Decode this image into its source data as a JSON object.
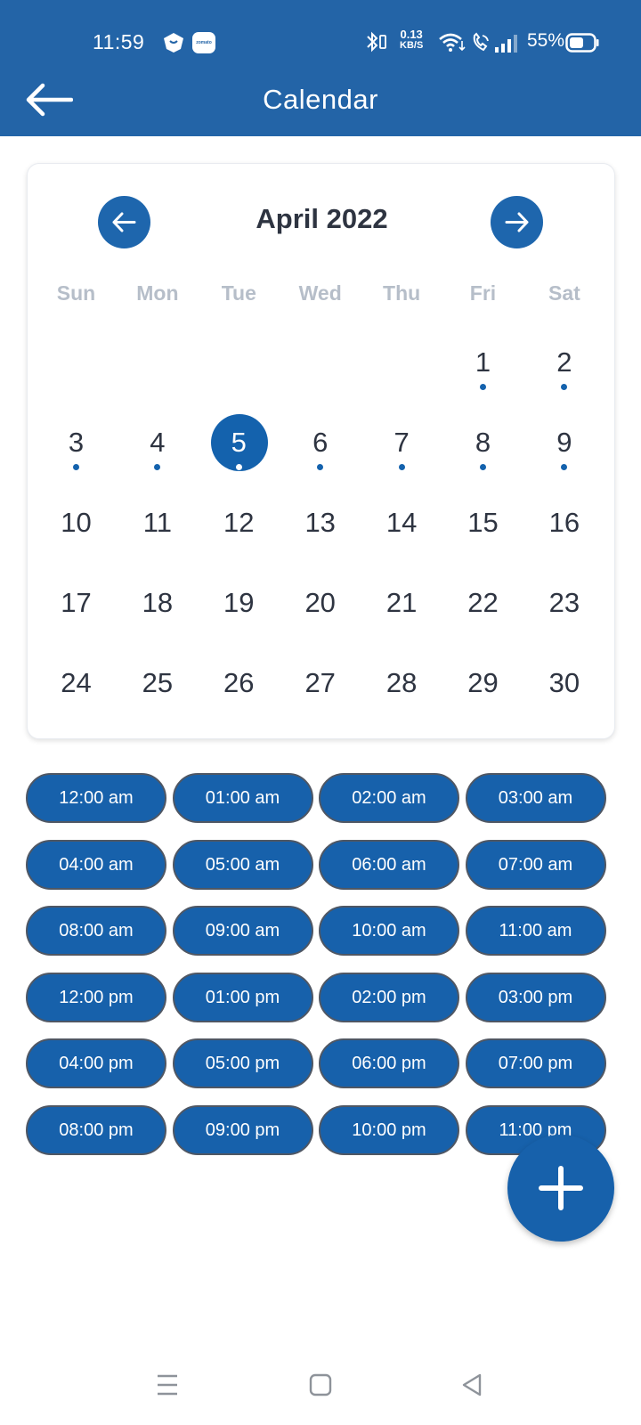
{
  "status_bar": {
    "time": "11:59",
    "speed_value": "0.13",
    "speed_unit": "KB/S",
    "battery": "55%",
    "app_badge": "zomato",
    "icons": [
      "app-notification-icon",
      "zomato-icon",
      "bluetooth-icon",
      "wifi-icon",
      "volte-call-icon",
      "signal-icon",
      "battery-icon"
    ]
  },
  "app_bar": {
    "title": "Calendar",
    "back_icon": "arrow-left-icon"
  },
  "calendar": {
    "month_title": "April 2022",
    "prev_icon": "arrow-left-icon",
    "next_icon": "arrow-right-icon",
    "weekdays": [
      "Sun",
      "Mon",
      "Tue",
      "Wed",
      "Thu",
      "Fri",
      "Sat"
    ],
    "first_weekday_index": 5,
    "days": [
      "1",
      "2",
      "3",
      "4",
      "5",
      "6",
      "7",
      "8",
      "9",
      "10",
      "11",
      "12",
      "13",
      "14",
      "15",
      "16",
      "17",
      "18",
      "19",
      "20",
      "21",
      "22",
      "23",
      "24",
      "25",
      "26",
      "27",
      "28",
      "29",
      "30"
    ],
    "selected_day": "5",
    "days_with_events": [
      "1",
      "2",
      "3",
      "4",
      "5",
      "6",
      "7",
      "8",
      "9"
    ]
  },
  "time_slots": [
    "12:00 am",
    "01:00 am",
    "02:00 am",
    "03:00 am",
    "04:00 am",
    "05:00 am",
    "06:00 am",
    "07:00 am",
    "08:00 am",
    "09:00 am",
    "10:00 am",
    "11:00 am",
    "12:00 pm",
    "01:00 pm",
    "02:00 pm",
    "03:00 pm",
    "04:00 pm",
    "05:00 pm",
    "06:00 pm",
    "07:00 pm",
    "08:00 pm",
    "09:00 pm",
    "10:00 pm",
    "11:00 pm"
  ],
  "fab": {
    "icon": "plus-icon"
  },
  "system_nav": {
    "icons": [
      "menu-icon",
      "home-icon",
      "back-icon"
    ]
  },
  "colors": {
    "primary": "#2364a7",
    "accent": "#1761ab",
    "weekday_text": "#b6bec9",
    "day_text": "#2e3441"
  }
}
